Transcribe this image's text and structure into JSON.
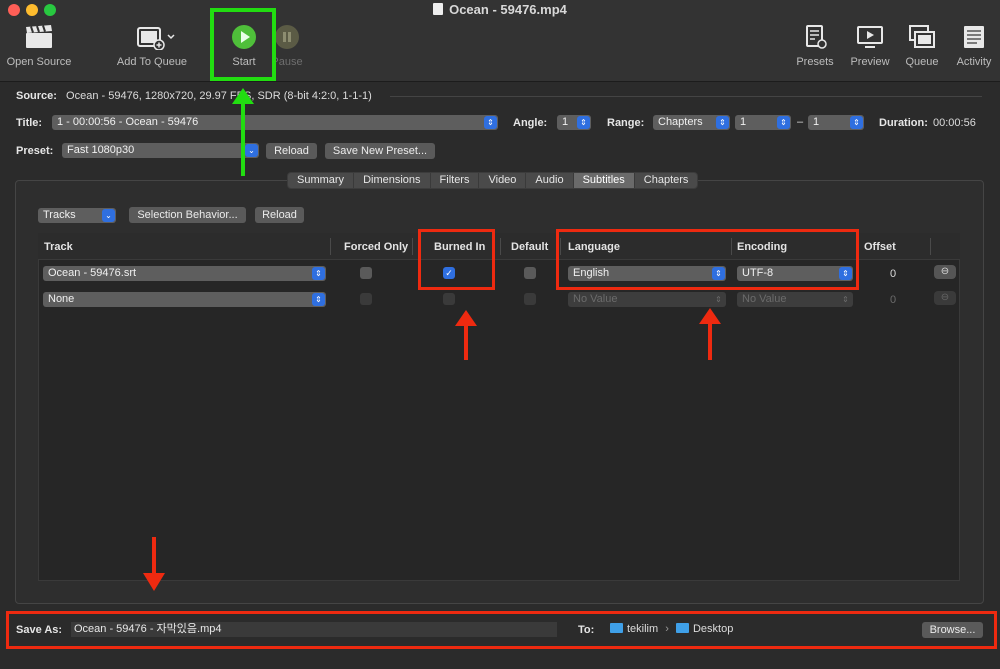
{
  "window": {
    "title": "Ocean - 59476.mp4"
  },
  "toolbar": {
    "open_source": "Open Source",
    "add_to_queue": "Add To Queue",
    "start": "Start",
    "pause": "Pause",
    "presets": "Presets",
    "preview": "Preview",
    "queue": "Queue",
    "activity": "Activity"
  },
  "source": {
    "label": "Source:",
    "value": "Ocean - 59476, 1280x720, 29.97 FPS, SDR (8-bit 4:2:0, 1-1-1)"
  },
  "title_row": {
    "label": "Title:",
    "value": "1 - 00:00:56 - Ocean - 59476",
    "angle_label": "Angle:",
    "angle": "1",
    "range_label": "Range:",
    "range_type": "Chapters",
    "range_start": "1",
    "range_sep": "–",
    "range_end": "1",
    "duration_label": "Duration:",
    "duration": "00:00:56"
  },
  "preset": {
    "label": "Preset:",
    "value": "Fast 1080p30",
    "reload": "Reload",
    "save_new": "Save New Preset..."
  },
  "tabs": [
    "Summary",
    "Dimensions",
    "Filters",
    "Video",
    "Audio",
    "Subtitles",
    "Chapters"
  ],
  "active_tab": "Subtitles",
  "subtitles": {
    "tracks_menu": "Tracks",
    "selection_behavior": "Selection Behavior...",
    "reload": "Reload",
    "columns": {
      "track": "Track",
      "forced_only": "Forced Only",
      "burned_in": "Burned In",
      "default": "Default",
      "language": "Language",
      "encoding": "Encoding",
      "offset": "Offset"
    },
    "rows": [
      {
        "track": "Ocean - 59476.srt",
        "forced_only": false,
        "burned_in": true,
        "default": false,
        "language": "English",
        "encoding": "UTF-8",
        "offset": "0"
      },
      {
        "track": "None",
        "forced_only": false,
        "burned_in": false,
        "default": false,
        "language": "No Value",
        "encoding": "No Value",
        "offset": "0"
      }
    ]
  },
  "save": {
    "label": "Save As:",
    "filename": "Ocean - 59476 - 자막있음.mp4",
    "to_label": "To:",
    "path_user": "tekilim",
    "path_sep": "›",
    "path_folder": "Desktop",
    "browse": "Browse..."
  },
  "colors": {
    "annotation_red": "#ee2a10",
    "annotation_green": "#22dd11",
    "accent": "#2f6fe0"
  }
}
